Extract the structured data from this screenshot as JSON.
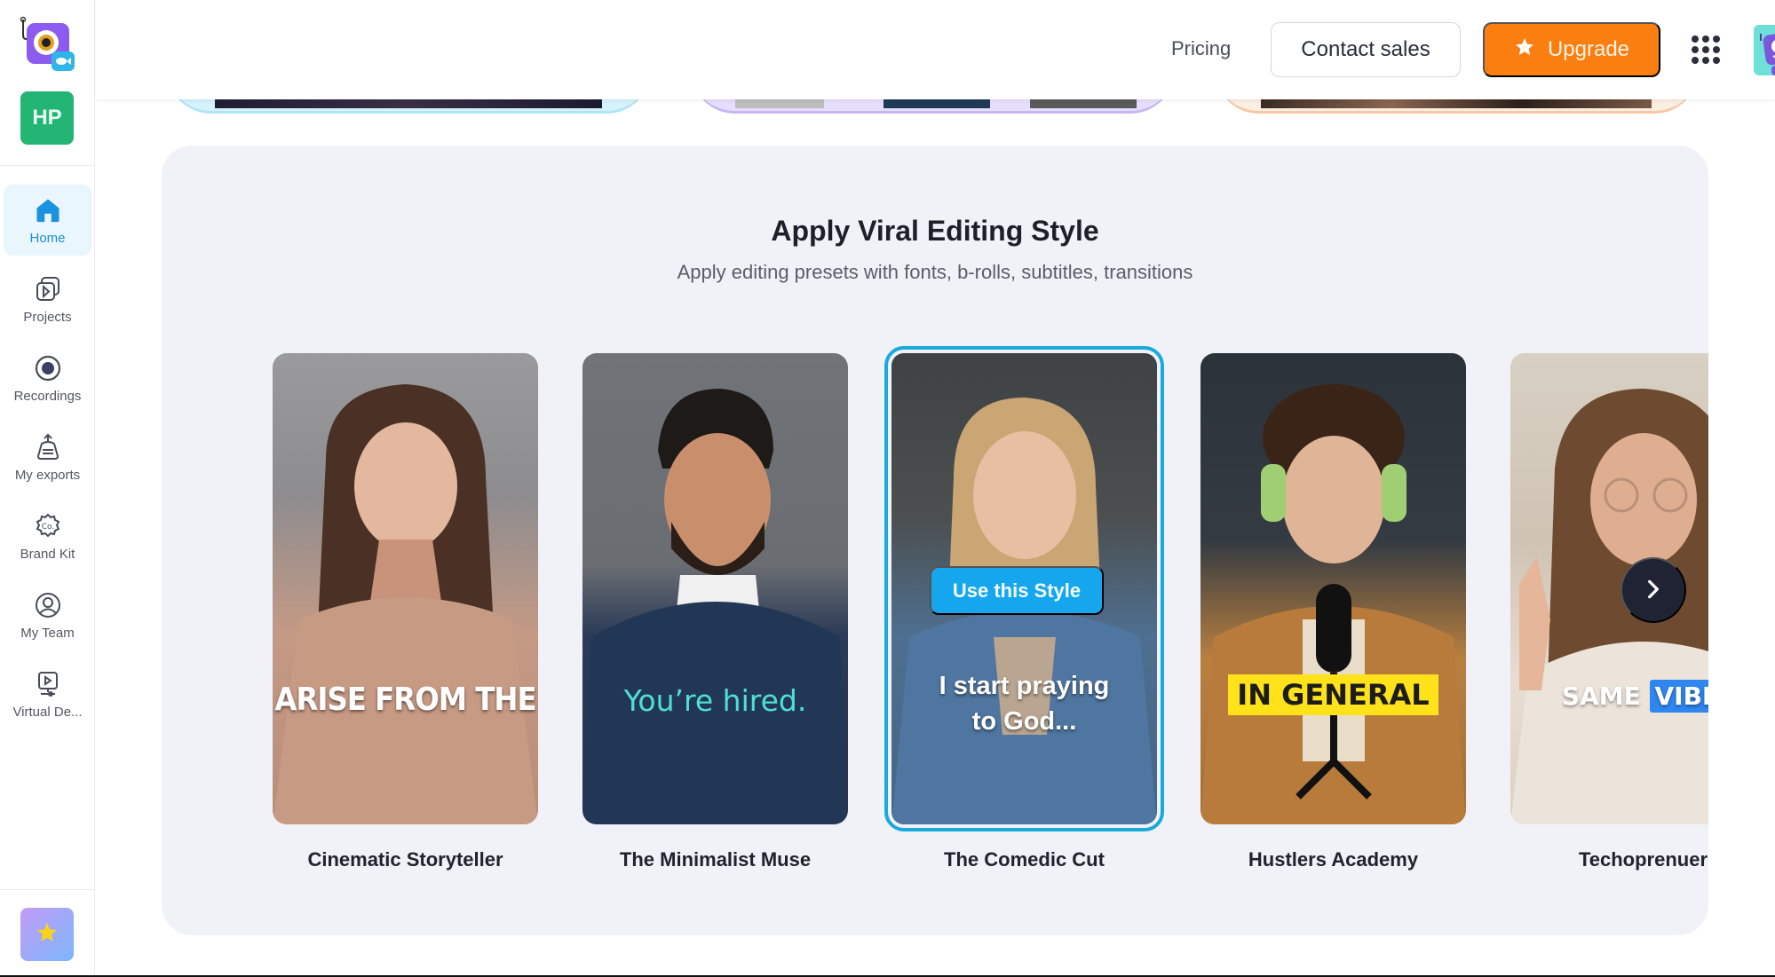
{
  "sidebar": {
    "workspace_initials": "HP",
    "items": [
      {
        "label": "Home",
        "icon": "home-icon",
        "active": true
      },
      {
        "label": "Projects",
        "icon": "projects-icon",
        "active": false
      },
      {
        "label": "Recordings",
        "icon": "record-icon",
        "active": false
      },
      {
        "label": "My exports",
        "icon": "exports-icon",
        "active": false
      },
      {
        "label": "Brand Kit",
        "icon": "brand-kit-icon",
        "active": false
      },
      {
        "label": "My Team",
        "icon": "team-icon",
        "active": false
      },
      {
        "label": "Virtual De...",
        "icon": "virtual-device-icon",
        "active": false
      }
    ],
    "premium_icon": "star-icon"
  },
  "header": {
    "pricing_label": "Pricing",
    "contact_label": "Contact sales",
    "upgrade_label": "Upgrade",
    "apps_icon": "grid-dots-icon",
    "profile_icon": "robot-avatar-icon"
  },
  "section": {
    "title": "Apply Viral Editing Style",
    "subtitle": "Apply editing presets with fonts, b-rolls, subtitles, transitions",
    "use_style_label": "Use this Style",
    "next_icon": "chevron-right-icon",
    "cards": [
      {
        "name": "Cinematic Storyteller",
        "caption": "ARISE FROM THE",
        "selected": false
      },
      {
        "name": "The Minimalist Muse",
        "caption": "You’re hired.",
        "selected": false
      },
      {
        "name": "The Comedic Cut",
        "caption_line1": "I start praying",
        "caption_line2": "to God...",
        "selected": true
      },
      {
        "name": "Hustlers Academy",
        "caption": "IN GENERAL",
        "selected": false
      },
      {
        "name": "Techoprenuer",
        "caption_word1": "SAME",
        "caption_word2": "VIBE",
        "selected": false
      }
    ]
  },
  "colors": {
    "accent": "#16a6ee",
    "upgrade": "#fb7f10",
    "workspace": "#22b573",
    "panel_bg": "#f1f2f7",
    "active_nav_bg": "#eaf6fd"
  }
}
